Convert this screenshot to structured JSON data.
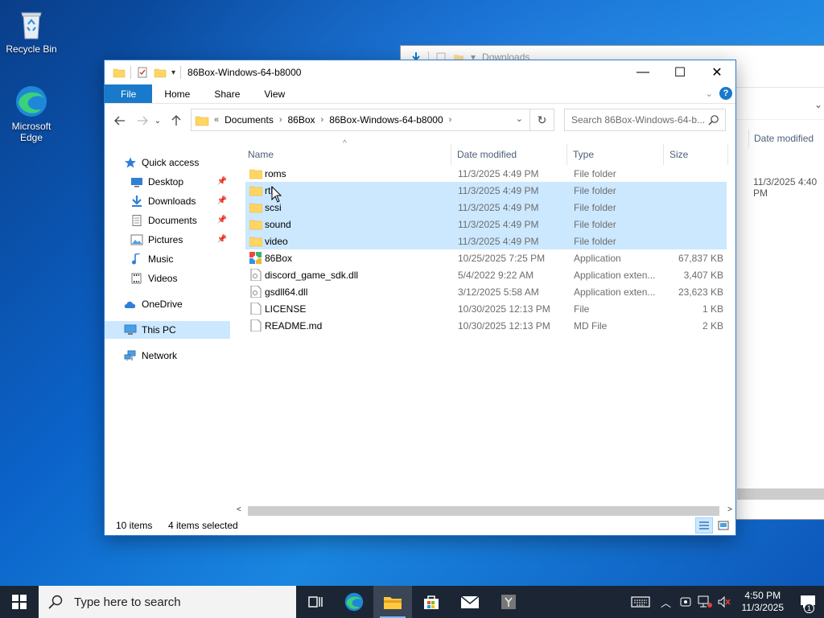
{
  "desktop": {
    "icons": [
      {
        "label": "Recycle Bin",
        "icon": "recycle-bin-icon"
      },
      {
        "label": "Microsoft Edge",
        "icon": "edge-icon"
      }
    ]
  },
  "background_window": {
    "title": "Downloads",
    "column_date_modified": "Date modified",
    "visible_value": "11/3/2025 4:40 PM"
  },
  "window": {
    "title": "86Box-Windows-64-b8000",
    "controls": {
      "minimize": "—",
      "maximize": "☐",
      "close": "✕"
    },
    "ribbon": {
      "tabs": [
        {
          "label": "File",
          "active": true
        },
        {
          "label": "Home"
        },
        {
          "label": "Share"
        },
        {
          "label": "View"
        }
      ]
    },
    "address": {
      "overflow": "«",
      "crumbs": [
        "Documents",
        "86Box",
        "86Box-Windows-64-b8000"
      ]
    },
    "search": {
      "placeholder": "Search 86Box-Windows-64-b..."
    },
    "navpane": {
      "items": [
        {
          "label": "Quick access",
          "icon": "star-icon"
        },
        {
          "label": "Desktop",
          "icon": "desktop-icon",
          "pinned": true
        },
        {
          "label": "Downloads",
          "icon": "download-arrow-icon",
          "pinned": true
        },
        {
          "label": "Documents",
          "icon": "document-icon",
          "pinned": true
        },
        {
          "label": "Pictures",
          "icon": "pictures-icon",
          "pinned": true
        },
        {
          "label": "Music",
          "icon": "music-note-icon"
        },
        {
          "label": "Videos",
          "icon": "video-icon"
        },
        {
          "label": "OneDrive",
          "icon": "cloud-icon"
        },
        {
          "label": "This PC",
          "icon": "computer-icon",
          "selected": true
        },
        {
          "label": "Network",
          "icon": "network-icon"
        }
      ]
    },
    "columns": {
      "name": "Name",
      "date": "Date modified",
      "type": "Type",
      "size": "Size"
    },
    "files": [
      {
        "name": "roms",
        "date": "11/3/2025 4:49 PM",
        "type": "File folder",
        "size": "",
        "icon": "folder-icon",
        "selected": false
      },
      {
        "name": "rtl",
        "date": "11/3/2025 4:49 PM",
        "type": "File folder",
        "size": "",
        "icon": "folder-icon",
        "selected": true
      },
      {
        "name": "scsi",
        "date": "11/3/2025 4:49 PM",
        "type": "File folder",
        "size": "",
        "icon": "folder-icon",
        "selected": true
      },
      {
        "name": "sound",
        "date": "11/3/2025 4:49 PM",
        "type": "File folder",
        "size": "",
        "icon": "folder-icon",
        "selected": true
      },
      {
        "name": "video",
        "date": "11/3/2025 4:49 PM",
        "type": "File folder",
        "size": "",
        "icon": "folder-icon",
        "selected": true
      },
      {
        "name": "86Box",
        "date": "10/25/2025 7:25 PM",
        "type": "Application",
        "size": "67,837 KB",
        "icon": "app-icon",
        "selected": false
      },
      {
        "name": "discord_game_sdk.dll",
        "date": "5/4/2022 9:22 AM",
        "type": "Application exten...",
        "size": "3,407 KB",
        "icon": "dll-icon",
        "selected": false
      },
      {
        "name": "gsdll64.dll",
        "date": "3/12/2025 5:58 AM",
        "type": "Application exten...",
        "size": "23,623 KB",
        "icon": "dll-icon",
        "selected": false
      },
      {
        "name": "LICENSE",
        "date": "10/30/2025 12:13 PM",
        "type": "File",
        "size": "1 KB",
        "icon": "file-icon",
        "selected": false
      },
      {
        "name": "README.md",
        "date": "10/30/2025 12:13 PM",
        "type": "MD File",
        "size": "2 KB",
        "icon": "file-icon",
        "selected": false
      }
    ],
    "status": {
      "count": "10 items",
      "selection": "4 items selected"
    }
  },
  "taskbar": {
    "search_placeholder": "Type here to search",
    "time": "4:50 PM",
    "date": "11/3/2025",
    "notification_count": "1"
  },
  "colors": {
    "accent": "#1979ca",
    "selection": "#cce8ff",
    "folder": "#ffd563",
    "taskbar": "#1b2533"
  }
}
